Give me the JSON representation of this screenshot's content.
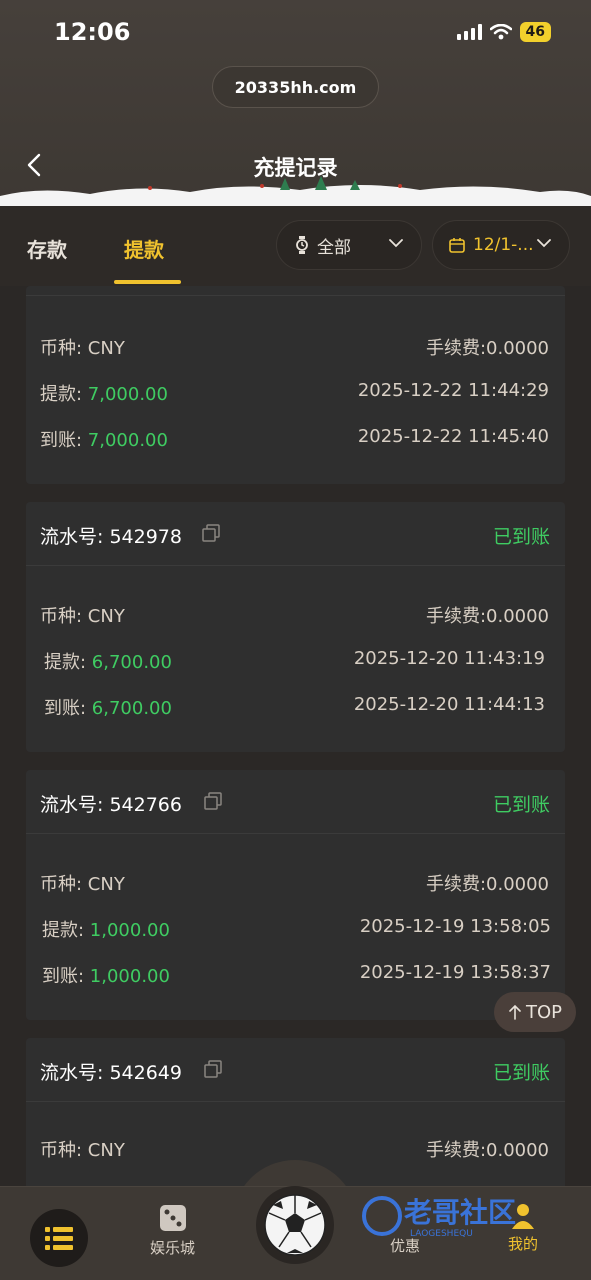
{
  "status_bar": {
    "time": "12:06",
    "battery": "46"
  },
  "header": {
    "url": "20335hh.com",
    "title": "充提记录"
  },
  "tabs": {
    "deposit": "存款",
    "withdraw": "提款"
  },
  "filters": {
    "type_value": "全部",
    "date_value": "12/1-..."
  },
  "records_partial": {
    "currency": "币种: CNY",
    "fee": "手续费:0.0000",
    "withdraw_label": "提款: ",
    "withdraw_amount": "7,000.00",
    "withdraw_time": "2025-12-22 11:44:29",
    "arrive_label": "到账: ",
    "arrive_amount": "7,000.00",
    "arrive_time": "2025-12-22 11:45:40"
  },
  "records": [
    {
      "serial": "流水号: 542978",
      "status": "已到账",
      "currency": "币种: CNY",
      "fee": "手续费:0.0000",
      "withdraw_label": "提款: ",
      "withdraw_amount": "6,700.00",
      "withdraw_time": "2025-12-20  11:43:19",
      "arrive_label": "到账: ",
      "arrive_amount": "6,700.00",
      "arrive_time": "2025-12-20  11:44:13"
    },
    {
      "serial": "流水号: 542766",
      "status": "已到账",
      "currency": "币种: CNY",
      "fee": "手续费:0.0000",
      "withdraw_label": "提款: ",
      "withdraw_amount": "1,000.00",
      "withdraw_time": "2025-12-19 13:58:05",
      "arrive_label": "到账: ",
      "arrive_amount": "1,000.00",
      "arrive_time": "2025-12-19 13:58:37"
    },
    {
      "serial": "流水号: 542649",
      "status": "已到账",
      "currency": "币种: CNY",
      "fee": "手续费:0.0000"
    }
  ],
  "top_button": "TOP",
  "bottom_nav": {
    "casino": "娱乐城",
    "promo": "优惠",
    "mine": "我的"
  },
  "watermark": {
    "text": "老哥社区",
    "subtext": "LAOGESHEQU"
  },
  "colors": {
    "accent": "#f0c22e",
    "success": "#3fcc62",
    "card": "#2f2f2f"
  }
}
